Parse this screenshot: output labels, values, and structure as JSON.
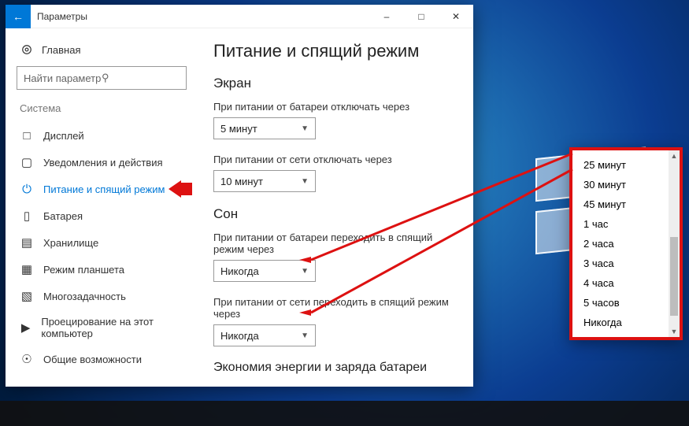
{
  "titlebar": {
    "title": "Параметры"
  },
  "sidebar": {
    "home": "Главная",
    "search_placeholder": "Найти параметр",
    "section": "Система",
    "items": [
      {
        "label": "Дисплей"
      },
      {
        "label": "Уведомления и действия"
      },
      {
        "label": "Питание и спящий режим"
      },
      {
        "label": "Батарея"
      },
      {
        "label": "Хранилище"
      },
      {
        "label": "Режим планшета"
      },
      {
        "label": "Многозадачность"
      },
      {
        "label": "Проецирование на этот компьютер"
      },
      {
        "label": "Общие возможности"
      }
    ]
  },
  "content": {
    "h1": "Питание и спящий режим",
    "screen": {
      "title": "Экран",
      "battery_label": "При питании от батареи отключать через",
      "battery_value": "5 минут",
      "plugged_label": "При питании от сети отключать через",
      "plugged_value": "10 минут"
    },
    "sleep": {
      "title": "Сон",
      "battery_label": "При питании от батареи переходить в спящий режим через",
      "battery_value": "Никогда",
      "plugged_label": "При питании от сети переходить в спящий режим через",
      "plugged_value": "Никогда"
    },
    "energy_title": "Экономия энергии и заряда батареи"
  },
  "dropdown_options": [
    "25 минут",
    "30 минут",
    "45 минут",
    "1 час",
    "2 часа",
    "3 часа",
    "4 часа",
    "5 часов",
    "Никогда"
  ]
}
